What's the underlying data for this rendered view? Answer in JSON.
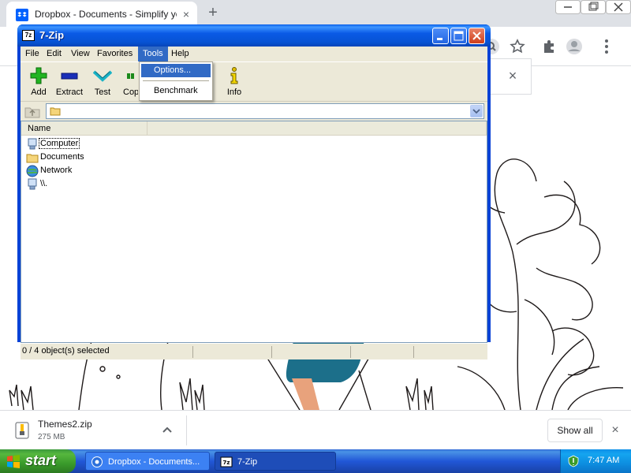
{
  "browser": {
    "tab_title": "Dropbox - Documents - Simplify your",
    "tab_close": "×",
    "new_tab": "+",
    "notice_close": "×"
  },
  "download": {
    "filename": "Themes2.zip",
    "size": "275 MB",
    "show_all": "Show all",
    "close": "×"
  },
  "taskbar": {
    "start": "start",
    "tasks": [
      {
        "label": "Dropbox - Documents..."
      },
      {
        "label": "7-Zip"
      }
    ],
    "clock": "7:47 AM"
  },
  "sevenzip": {
    "title": "7-Zip",
    "app_icon_text": "7z",
    "menu": [
      "File",
      "Edit",
      "View",
      "Favorites",
      "Tools",
      "Help"
    ],
    "active_menu": "Tools",
    "toolbar": [
      {
        "label": "Add",
        "icon": "add-icon"
      },
      {
        "label": "Extract",
        "icon": "extract-icon"
      },
      {
        "label": "Test",
        "icon": "test-icon"
      },
      {
        "label": "Copy",
        "icon": "copy-icon"
      },
      {
        "label": "Info",
        "icon": "info-icon"
      }
    ],
    "columns": [
      "Name"
    ],
    "items": [
      {
        "name": "Computer",
        "icon": "computer-icon"
      },
      {
        "name": "Documents",
        "icon": "folder-icon"
      },
      {
        "name": "Network",
        "icon": "network-icon"
      },
      {
        "name": "\\\\.",
        "icon": "drive-icon"
      }
    ],
    "status": "0 / 4 object(s) selected"
  },
  "tools_menu": {
    "items": [
      "Options...",
      "Benchmark"
    ],
    "highlighted": "Options..."
  },
  "colors": {
    "xp_title_blue": "#0842d6",
    "menu_highlight": "#316ac5",
    "start_green": "#3a9b2b"
  }
}
